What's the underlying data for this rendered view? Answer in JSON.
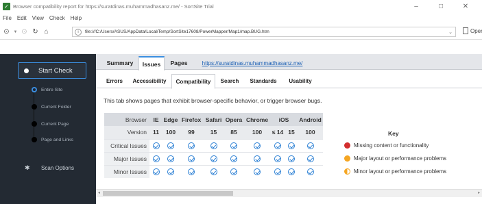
{
  "window": {
    "title": "Browser compatibility report for https://suratdinas.muhammadhasanz.me/ - SortSite Trial",
    "minimize": "–",
    "maximize": "□",
    "close": "✕"
  },
  "menu": [
    "File",
    "Edit",
    "View",
    "Check",
    "Help"
  ],
  "address": {
    "url": "file:///C:/Users/ASUS/AppData/Local/Temp/SortSite17608/PowerMapper/Map1/map.BUG.htm",
    "open_label": "Open..."
  },
  "sidebar": {
    "start_check": "Start Check",
    "sub_items": [
      "Entire Site",
      "Current Folder",
      "Current Page",
      "Page and Links"
    ],
    "scan_options": "Scan Options"
  },
  "top_tabs": {
    "summary": "Summary",
    "issues": "Issues",
    "pages": "Pages",
    "link": "https://suratdinas.muhammadhasanz.me/"
  },
  "sub_tabs": [
    "Errors",
    "Accessibility",
    "Compatibility",
    "Search",
    "Standards",
    "Usability"
  ],
  "description": "This tab shows pages that exhibit browser-specific behavior, or trigger browser bugs.",
  "table": {
    "browser_label": "Browser",
    "version_label": "Version",
    "browsers": [
      "IE",
      "Edge",
      "Firefox",
      "Safari",
      "Opera",
      "Chrome",
      "iOS",
      "Android"
    ],
    "versions": [
      "11",
      "100",
      "99",
      "15",
      "85",
      "100",
      "≤ 14",
      "15",
      "100"
    ],
    "rows": [
      "Critical Issues",
      "Major Issues",
      "Minor Issues"
    ]
  },
  "key": {
    "title": "Key",
    "items": [
      {
        "label": "Missing content or functionality",
        "color": "#d32f2f"
      },
      {
        "label": "Major layout or performance problems",
        "color": "#f5a623"
      },
      {
        "label": "Minor layout or performance problems",
        "color": "#f5a623"
      }
    ]
  }
}
